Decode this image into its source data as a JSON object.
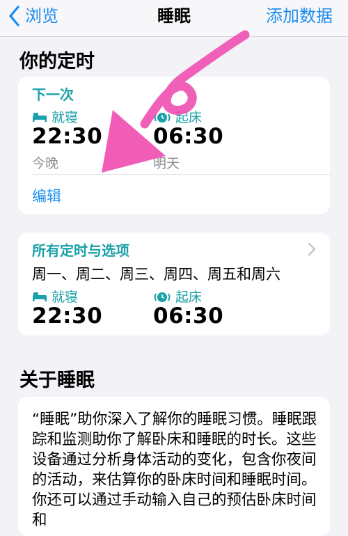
{
  "nav": {
    "back_label": "浏览",
    "title": "睡眠",
    "action_label": "添加数据"
  },
  "schedule": {
    "section_title": "你的定时",
    "next": {
      "heading": "下一次",
      "bedtime_label": "就寝",
      "bedtime_value": "22:30",
      "bedtime_day": "今晚",
      "wake_label": "起床",
      "wake_value": "06:30",
      "wake_day": "明天",
      "edit_label": "编辑"
    },
    "all": {
      "heading": "所有定时与选项",
      "days": "周一、周二、周三、周四、周五和周六",
      "bedtime_label": "就寝",
      "bedtime_value": "22:30",
      "wake_label": "起床",
      "wake_value": "06:30"
    }
  },
  "about": {
    "section_title": "关于睡眠",
    "text": "“睡眠”助你深入了解你的睡眠习惯。睡眠跟踪和监测助你了解卧床和睡眠的时长。这些设备通过分析身体活动的变化，包含你夜间的活动，来估算你的卧床时间和睡眠时间。你还可以通过手动输入自己的预估卧床时间和"
  },
  "colors": {
    "accent": "#1a8cf0",
    "teal": "#1aa0a8",
    "annotation": "#f04fb0"
  },
  "icons": [
    "chevron-left-icon",
    "bed-icon",
    "alarm-icon",
    "chevron-right-icon"
  ]
}
